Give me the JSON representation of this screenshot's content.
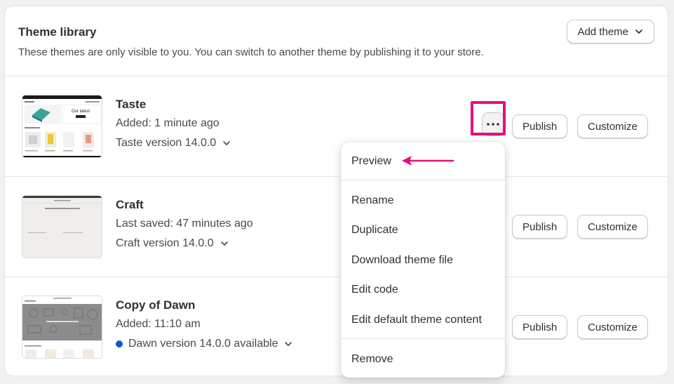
{
  "header": {
    "title": "Theme library",
    "description": "These themes are only visible to you. You can switch to another theme by publishing it to your store.",
    "add_theme_label": "Add theme"
  },
  "themes": [
    {
      "name": "Taste",
      "meta": "Added: 1 minute ago",
      "version": "Taste version 14.0.0",
      "thumb_text": "Our latest",
      "publish_label": "Publish",
      "customize_label": "Customize"
    },
    {
      "name": "Craft",
      "meta": "Last saved: 47 minutes ago",
      "version": "Craft version 14.0.0",
      "publish_label": "Publish",
      "customize_label": "Customize"
    },
    {
      "name": "Copy of Dawn",
      "meta": "Added: 11:10 am",
      "version": "Dawn version 14.0.0 available",
      "publish_label": "Publish",
      "customize_label": "Customize"
    }
  ],
  "menu": {
    "preview": "Preview",
    "rename": "Rename",
    "duplicate": "Duplicate",
    "download": "Download theme file",
    "edit_code": "Edit code",
    "edit_default": "Edit default theme content",
    "remove": "Remove"
  },
  "colors": {
    "highlight": "#e3117c",
    "update_dot": "#005bd3"
  }
}
